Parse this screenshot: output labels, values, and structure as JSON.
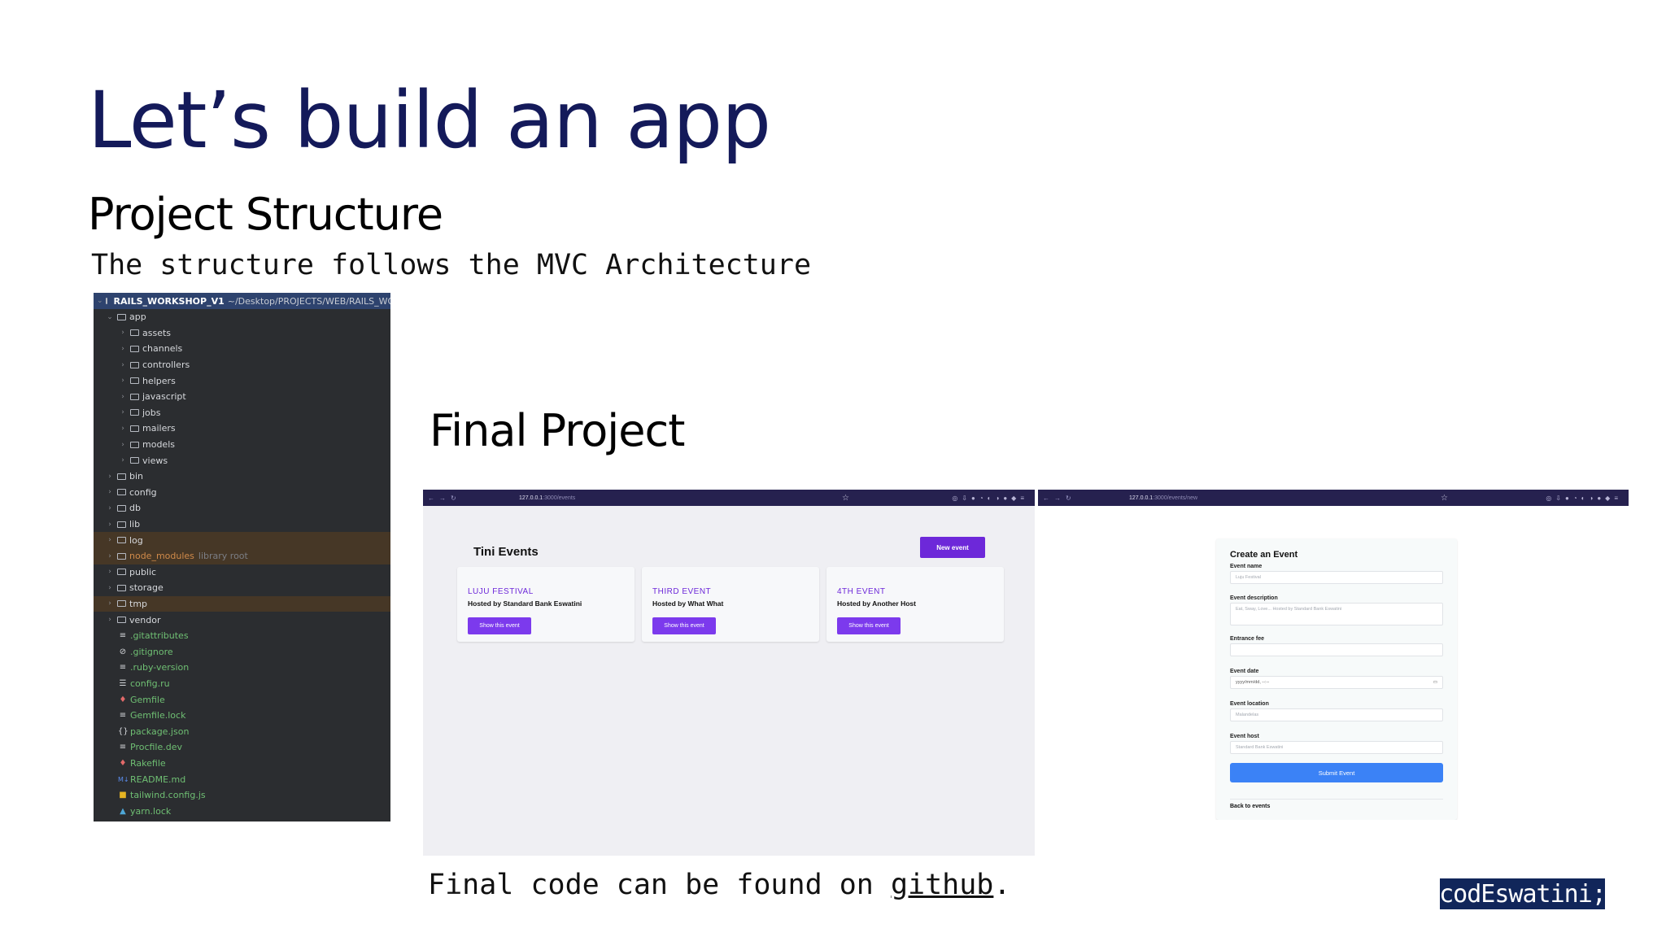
{
  "slide": {
    "title": "Let’s build an app",
    "structure_heading": "Project Structure",
    "structure_note": "The structure follows the MVC Architecture",
    "final_heading": "Final Project",
    "footer_prefix": "Final code can be found on ",
    "footer_link": "github",
    "footer_suffix": ".",
    "brand": "codEswatini;"
  },
  "tree": {
    "root": "RAILS_WORKSHOP_V1",
    "root_path": "~/Desktop/PROJECTS/WEB/RAILS_WORKS",
    "app": "app",
    "app_children": [
      "assets",
      "channels",
      "controllers",
      "helpers",
      "javascript",
      "jobs",
      "mailers",
      "models",
      "views"
    ],
    "folders": [
      "bin",
      "config",
      "db",
      "lib",
      "log",
      "node_modules",
      "public",
      "storage",
      "tmp",
      "vendor"
    ],
    "node_modules_note": "library root",
    "files": [
      ".gitattributes",
      ".gitignore",
      ".ruby-version",
      "config.ru",
      "Gemfile",
      "Gemfile.lock",
      "package.json",
      "Procfile.dev",
      "Rakefile",
      "README.md",
      "tailwind.config.js",
      "yarn.lock"
    ],
    "highlight_color": "#463726"
  },
  "events_page": {
    "url_host": "127.0.0.1",
    "url_path": ":3000/events",
    "app_title": "Tini Events",
    "new_button": "New event",
    "cards": [
      {
        "title": "LUJU FESTIVAL",
        "host": "Hosted by Standard Bank Eswatini",
        "button": "Show this event"
      },
      {
        "title": "THIRD EVENT",
        "host": "Hosted by What What",
        "button": "Show this event"
      },
      {
        "title": "4TH EVENT",
        "host": "Hosted by Another Host",
        "button": "Show this event"
      }
    ],
    "accent": "#6d28d9"
  },
  "form_page": {
    "url_host": "127.0.0.1",
    "url_path": ":3000/events/new",
    "title": "Create an Event",
    "fields": {
      "name_label": "Event name",
      "name_placeholder": "Luju Festival",
      "desc_label": "Event description",
      "desc_placeholder": "Eat, Sway, Love... Hosted by Standard Bank Eswatini",
      "fee_label": "Entrance fee",
      "date_label": "Event date",
      "date_placeholder": "yyyy/mm/dd, --:--",
      "location_label": "Event location",
      "location_placeholder": "Malandelas",
      "host_label": "Event host",
      "host_placeholder": "Standard Bank Eswatini"
    },
    "submit": "Submit Event",
    "back": "Back to events",
    "accent": "#3b82f6"
  }
}
